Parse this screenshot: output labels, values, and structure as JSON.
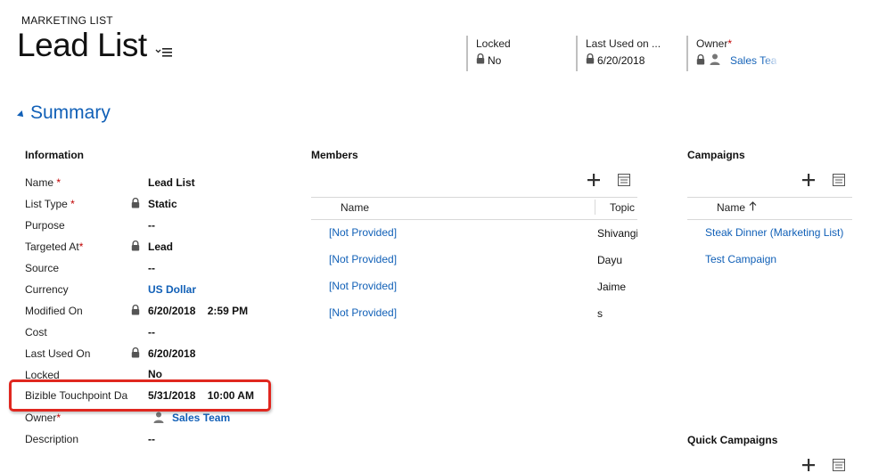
{
  "header": {
    "entity_label": "MARKETING LIST",
    "title": "Lead List",
    "fields": [
      {
        "label": "Locked",
        "value": "No"
      },
      {
        "label": "Last Used on ...",
        "value": "6/20/2018"
      },
      {
        "label": "Owner",
        "value": "Sales Tea"
      }
    ]
  },
  "summary": {
    "title": "Summary",
    "information": {
      "title": "Information",
      "rows": [
        {
          "label": "Name",
          "value": "Lead List"
        },
        {
          "label": "List Type",
          "value": "Static"
        },
        {
          "label": "Purpose",
          "value": "--"
        },
        {
          "label": "Targeted At",
          "value": "Lead"
        },
        {
          "label": "Source",
          "value": "--"
        },
        {
          "label": "Currency",
          "value": "US Dollar"
        },
        {
          "label": "Modified On",
          "value": "6/20/2018    2:59 PM"
        },
        {
          "label": "Cost",
          "value": "--"
        },
        {
          "label": "Last Used On",
          "value": "6/20/2018"
        },
        {
          "label": "Locked",
          "value": "No"
        },
        {
          "label": "Bizible Touchpoint Da",
          "value": "5/31/2018    10:00 AM"
        },
        {
          "label": "Owner",
          "value": "Sales Team"
        },
        {
          "label": "Description",
          "value": "--"
        }
      ]
    },
    "members": {
      "title": "Members",
      "columns": [
        "Name",
        "Topic"
      ],
      "rows": [
        {
          "name": "[Not Provided]",
          "topic": "Shivangi"
        },
        {
          "name": "[Not Provided]",
          "topic": "Dayu"
        },
        {
          "name": "[Not Provided]",
          "topic": "Jaime"
        },
        {
          "name": "[Not Provided]",
          "topic": "s"
        }
      ]
    },
    "campaigns": {
      "title": "Campaigns",
      "column": "Name",
      "rows": [
        "Steak Dinner (Marketing List)",
        "Test Campaign"
      ]
    },
    "quick_campaigns": {
      "title": "Quick Campaigns"
    }
  },
  "colors": {
    "link": "#1160b7",
    "required": "#c00000",
    "highlight": "#e0271f"
  }
}
